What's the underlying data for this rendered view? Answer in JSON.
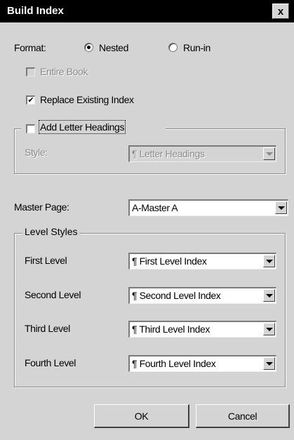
{
  "window": {
    "title": "Build Index",
    "close_label": "x"
  },
  "format": {
    "label": "Format:",
    "options": [
      "Nested",
      "Run-in"
    ],
    "selected": "Nested"
  },
  "entire_book": {
    "label": "Entire Book",
    "checked": false,
    "enabled": false
  },
  "replace_existing": {
    "label": "Replace Existing Index",
    "checked": true,
    "mark": "✔"
  },
  "letter_headings": {
    "label": "Add Letter Headings",
    "checked": false,
    "style_label": "Style:",
    "style_value": "¶ Letter Headings"
  },
  "master_page": {
    "label": "Master Page:",
    "value": "A-Master A"
  },
  "level_styles": {
    "legend": "Level Styles",
    "levels": [
      {
        "label": "First Level",
        "value": "¶ First Level Index"
      },
      {
        "label": "Second Level",
        "value": "¶ Second Level Index"
      },
      {
        "label": "Third Level",
        "value": "¶ Third Level Index"
      },
      {
        "label": "Fourth Level",
        "value": "¶ Fourth Level Index"
      }
    ]
  },
  "buttons": {
    "ok": "OK",
    "cancel": "Cancel"
  }
}
